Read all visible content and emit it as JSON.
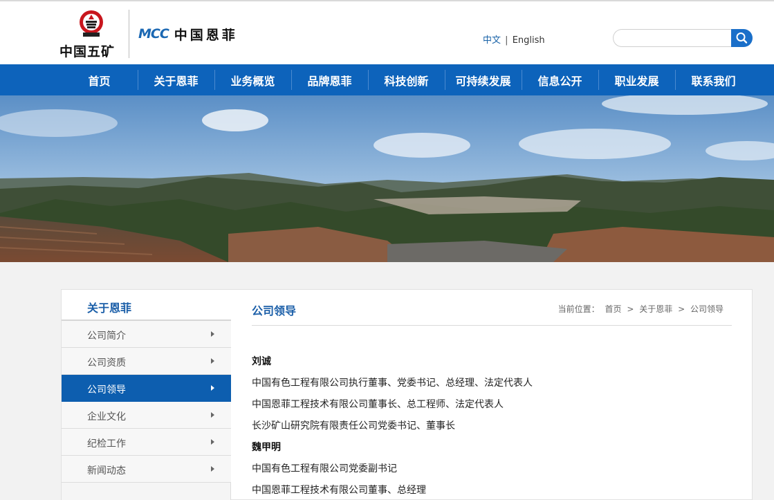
{
  "header": {
    "brand_minmetals": "中国五矿",
    "brand_mcc_mark": "MCC",
    "brand_mcc_name": "中国恩菲",
    "lang_zh": "中文",
    "lang_sep": "|",
    "lang_en": "English",
    "search_placeholder": ""
  },
  "nav": {
    "items": [
      {
        "label": "首页"
      },
      {
        "label": "关于恩菲"
      },
      {
        "label": "业务概览"
      },
      {
        "label": "品牌恩菲"
      },
      {
        "label": "科技创新"
      },
      {
        "label": "可持续发展"
      },
      {
        "label": "信息公开"
      },
      {
        "label": "职业发展"
      },
      {
        "label": "联系我们"
      }
    ]
  },
  "sidebar": {
    "title": "关于恩菲",
    "items": [
      {
        "label": "公司简介",
        "active": false
      },
      {
        "label": "公司资质",
        "active": false
      },
      {
        "label": "公司领导",
        "active": true
      },
      {
        "label": "企业文化",
        "active": false
      },
      {
        "label": "纪检工作",
        "active": false
      },
      {
        "label": "新闻动态",
        "active": false
      }
    ]
  },
  "main": {
    "title": "公司领导",
    "breadcrumb": {
      "prefix": "当前位置：",
      "items": [
        "首页",
        "关于恩菲",
        "公司领导"
      ],
      "sep": ">"
    },
    "leaders": [
      {
        "name": "刘诚",
        "roles": [
          "中国有色工程有限公司执行董事、党委书记、总经理、法定代表人",
          "中国恩菲工程技术有限公司董事长、总工程师、法定代表人",
          "长沙矿山研究院有限责任公司党委书记、董事长"
        ]
      },
      {
        "name": "魏甲明",
        "roles": [
          "中国有色工程有限公司党委副书记",
          "中国恩菲工程技术有限公司董事、总经理"
        ]
      }
    ]
  },
  "colors": {
    "nav_blue": "#0d63bb",
    "accent_blue": "#1a5ea8",
    "search_blue": "#1a6fc9",
    "active_item": "#0d5eaf"
  }
}
